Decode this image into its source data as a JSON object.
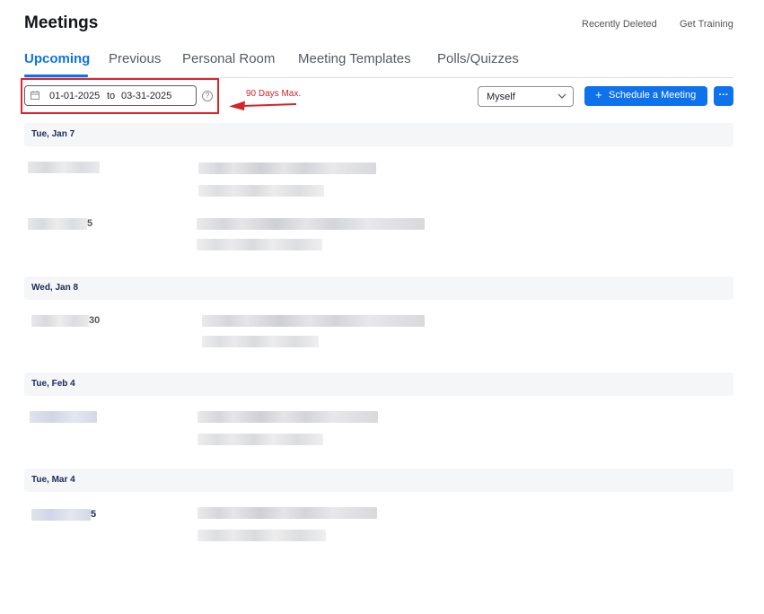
{
  "header": {
    "title": "Meetings",
    "recently_deleted": "Recently Deleted",
    "get_training": "Get Training"
  },
  "tabs": [
    {
      "label": "Upcoming",
      "active": true
    },
    {
      "label": "Previous"
    },
    {
      "label": "Personal Room"
    },
    {
      "label": "Meeting Templates"
    },
    {
      "label": "Polls/Quizzes"
    }
  ],
  "filter": {
    "start_date": "01-01-2025",
    "separator": "to",
    "end_date": "03-31-2025",
    "annotation": "90 Days Max.",
    "owner_select": "Myself",
    "schedule_button": "Schedule a Meeting",
    "schedule_icon": "+",
    "more_button": "···"
  },
  "colors": {
    "accent": "#0e72ed",
    "annotation_red": "#e0242c",
    "day_header_bg": "#f5f6f8"
  },
  "days": [
    {
      "label": "Tue, Jan 7"
    },
    {
      "label": "Wed, Jan 8"
    },
    {
      "label": "Tue, Feb 4"
    },
    {
      "label": "Tue, Mar 4"
    }
  ],
  "meetings": [
    {
      "time_suffix": ""
    },
    {
      "time_suffix": "5"
    },
    {
      "time_suffix": "30"
    },
    {
      "time_suffix": ""
    },
    {
      "time_suffix": "5"
    }
  ]
}
